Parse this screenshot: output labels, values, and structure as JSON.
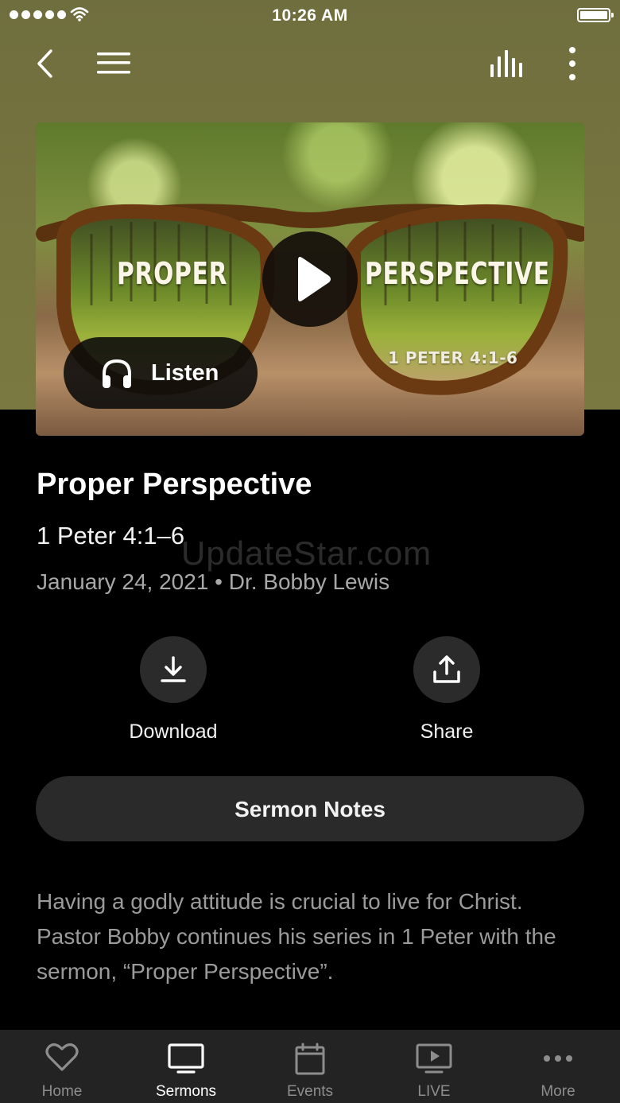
{
  "status_bar": {
    "time": "10:26 AM"
  },
  "nav": {
    "back_icon": "chevron-left-icon",
    "menu_icon": "hamburger-menu-icon",
    "audio_icon": "audio-bars-icon",
    "more_icon": "vertical-dots-icon"
  },
  "artwork": {
    "title_left": "PROPER",
    "title_right": "PERSPECTIVE",
    "scripture_ref": "1 PETER 4:1-6",
    "listen_label": "Listen"
  },
  "sermon": {
    "title": "Proper Perspective",
    "scripture": "1 Peter 4:1–6",
    "meta": "January 24, 2021 • Dr. Bobby Lewis",
    "watermark": "UpdateStar.com"
  },
  "actions": {
    "download_label": "Download",
    "share_label": "Share"
  },
  "notes_button": "Sermon Notes",
  "description": "Having a godly attitude is crucial to live for Christ. Pastor Bobby continues his series in 1 Peter with the sermon, “Proper Perspective”.",
  "tabs": [
    {
      "label": "Home",
      "icon": "heart-icon"
    },
    {
      "label": "Sermons",
      "icon": "monitor-icon",
      "active": true
    },
    {
      "label": "Events",
      "icon": "calendar-icon"
    },
    {
      "label": "LIVE",
      "icon": "tv-play-icon"
    },
    {
      "label": "More",
      "icon": "ellipsis-icon"
    }
  ],
  "colors": {
    "header_bg": "#77763f",
    "page_bg": "#000000",
    "tabbar_bg": "#232323",
    "button_bg": "#2a2a2a"
  }
}
